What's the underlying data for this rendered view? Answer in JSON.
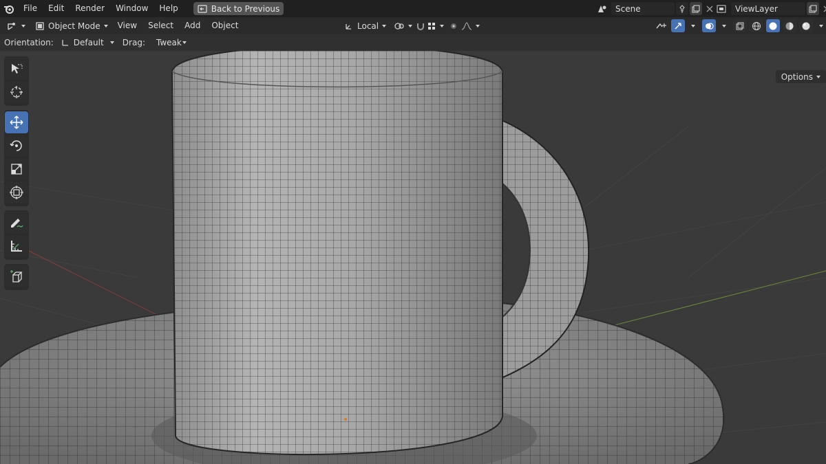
{
  "menubar": {
    "items": [
      "File",
      "Edit",
      "Render",
      "Window",
      "Help"
    ],
    "back_button": "Back to Previous"
  },
  "scene": {
    "name": "Scene"
  },
  "view_layer": {
    "name": "ViewLayer"
  },
  "header": {
    "mode": "Object Mode",
    "menus": [
      "View",
      "Select",
      "Add",
      "Object"
    ],
    "transform_pivot": "Local"
  },
  "tool_settings": {
    "orientation_label": "Orientation:",
    "orientation_value": "Default",
    "drag_label": "Drag:",
    "drag_value": "Tweak",
    "options": "Options"
  },
  "tools": [
    "select-box",
    "cursor",
    "move",
    "rotate",
    "scale",
    "transform",
    "annotate",
    "measure",
    "add-cube"
  ],
  "active_tool": "move",
  "colors": {
    "accent": "#4772b3",
    "topbar": "#202020",
    "viewport_bg": "#3a3a3a"
  }
}
